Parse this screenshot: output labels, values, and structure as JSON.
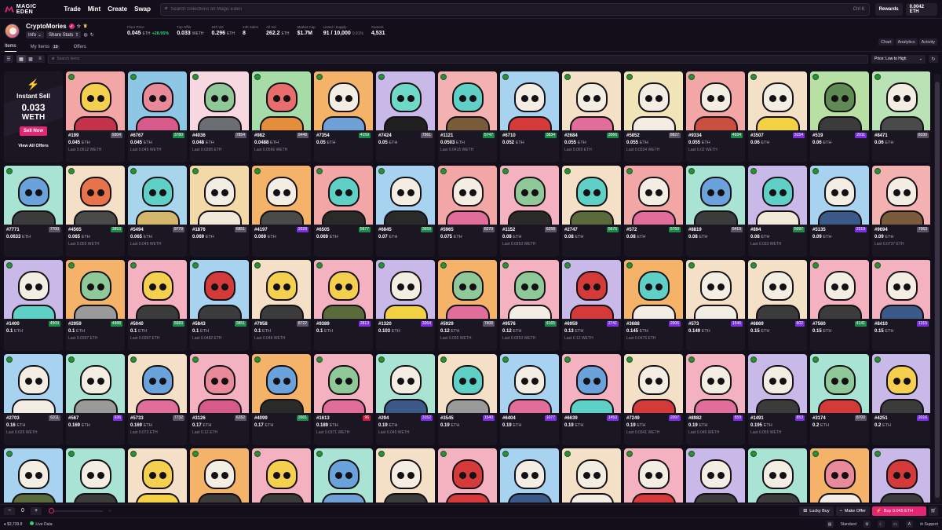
{
  "nav": {
    "logo_text": "MAGIC EDEN",
    "links": [
      "Trade",
      "Mint",
      "Create",
      "Swap"
    ],
    "search_placeholder": "Search collections on Magic Eden",
    "search_shortcut": "Ctrl K",
    "rewards_label": "Rewards",
    "balance": "0.0042 ETH"
  },
  "collection": {
    "name": "CryptoMories",
    "info_label": "Info",
    "share_label": "Share Stats",
    "stats": [
      {
        "label": "Floor Price",
        "value": "0.045",
        "unit": "ETH",
        "extra": "+28.95%"
      },
      {
        "label": "Top Offer",
        "value": "0.033",
        "unit": "WETH",
        "extra": ""
      },
      {
        "label": "24h Vol",
        "value": "0.296",
        "unit": "ETH",
        "extra": ""
      },
      {
        "label": "24h Sales",
        "value": "8",
        "unit": "",
        "extra": ""
      },
      {
        "label": "All Vol",
        "value": "262.2",
        "unit": "ETH",
        "extra": ""
      },
      {
        "label": "Market Cap",
        "value": "$1.7M",
        "unit": "",
        "extra": ""
      },
      {
        "label": "Listed / Supply",
        "value": "91 / 10,000",
        "unit": "",
        "extra": "0.91%"
      },
      {
        "label": "Owners",
        "value": "4,531",
        "unit": "",
        "extra": ""
      }
    ]
  },
  "tabs": {
    "items": "Items",
    "my_items": "My Items",
    "my_items_count": "19",
    "offers": "Offers",
    "right": [
      "Chart",
      "Analytics",
      "Activity"
    ]
  },
  "toolbar": {
    "search_placeholder": "Search items",
    "sort_label": "Price: Low to High"
  },
  "instant_sell": {
    "title": "Instant Sell",
    "value": "0.033",
    "unit": "WETH",
    "button": "Sell Now",
    "view_all": "View All Offers"
  },
  "colors": {
    "accent": "#e42575",
    "rank_gray": "#5b5368",
    "rank_green": "#1d8a4c",
    "rank_purple": "#7a2fe0",
    "rank_red": "#d11a3c"
  },
  "items": [
    {
      "id": "#199",
      "rank": "9304",
      "tier": "gray",
      "price": "0.045",
      "last": "Last 0.0512 WETH",
      "bg": "#f3a6a6",
      "skull": "#f4d04e",
      "body": "#c4334b"
    },
    {
      "id": "#6767",
      "rank": "3780",
      "tier": "green",
      "price": "0.045",
      "last": "Last 0.045 WETH",
      "bg": "#8ec7e6",
      "skull": "#e98a9b",
      "body": "#d65a8a"
    },
    {
      "id": "#4036",
      "rank": "7854",
      "tier": "gray",
      "price": "0.048",
      "last": "Last 0.0395 ETH",
      "bg": "#f7d8e0",
      "skull": "#8fc99a",
      "body": "#6c6e74"
    },
    {
      "id": "#982",
      "rank": "9448",
      "tier": "gray",
      "price": "0.0488",
      "last": "Last 0.0566 WETH",
      "bg": "#a5dca8",
      "skull": "#ea6d6d",
      "body": "#e48d3a"
    },
    {
      "id": "#7354",
      "rank": "4159",
      "tier": "green",
      "price": "0.05",
      "last": "",
      "bg": "#f5b36a",
      "skull": "#f4ede4",
      "body": "#6fa0d6"
    },
    {
      "id": "#7424",
      "rank": "7561",
      "tier": "gray",
      "price": "0.05",
      "last": "",
      "bg": "#c9b9e8",
      "skull": "#6ed9c7",
      "body": "#202020"
    },
    {
      "id": "#1121",
      "rank": "5747",
      "tier": "green",
      "price": "0.0503",
      "last": "Last 0.0415 WETH",
      "bg": "#f4b1b1",
      "skull": "#5fd0c5",
      "body": "#7a5c3a"
    },
    {
      "id": "#6710",
      "rank": "3834",
      "tier": "green",
      "price": "0.052",
      "last": "",
      "bg": "#a7d2f0",
      "skull": "#f4ede4",
      "body": "#d43a3a"
    },
    {
      "id": "#2684",
      "rank": "3566",
      "tier": "green",
      "price": "0.055",
      "last": "Last 0.069 ETH",
      "bg": "#f4e0c7",
      "skull": "#f4ede4",
      "body": "#e06d9a"
    },
    {
      "id": "#5852",
      "rank": "8827",
      "tier": "gray",
      "price": "0.055",
      "last": "Last 0.0324 WETH",
      "bg": "#f0e4b8",
      "skull": "#f4ede4",
      "body": "#f4ede4"
    },
    {
      "id": "#9334",
      "rank": "4934",
      "tier": "green",
      "price": "0.055",
      "last": "Last 0.02 WETH",
      "bg": "#f2a6a6",
      "skull": "#f4ede4",
      "body": "#c9503f"
    },
    {
      "id": "#3507",
      "rank": "3154",
      "tier": "purple",
      "price": "0.06",
      "last": "",
      "bg": "#f4e0c7",
      "skull": "#f4ede4",
      "body": "#f2d244"
    },
    {
      "id": "#519",
      "rank": "2011",
      "tier": "purple",
      "price": "0.06",
      "last": "",
      "bg": "#b8e0a5",
      "skull": "#5f8a54",
      "body": "#3b3b3b"
    },
    {
      "id": "#8471",
      "rank": "8330",
      "tier": "gray",
      "price": "0.06",
      "last": "",
      "bg": "#b9e3b5",
      "skull": "#f4ede4",
      "body": "#4a4a4a"
    },
    {
      "id": "#7771",
      "rank": "7700",
      "tier": "gray",
      "price": "0.0633",
      "last": "",
      "bg": "#a9e3d3",
      "skull": "#6aa2dc",
      "body": "#3b3b3b"
    },
    {
      "id": "#4565",
      "rank": "3853",
      "tier": "green",
      "price": "0.065",
      "last": "Last 0.055 WETH",
      "bg": "#f4e0c7",
      "skull": "#e8734a",
      "body": "#4a4a4a"
    },
    {
      "id": "#5494",
      "rank": "9779",
      "tier": "gray",
      "price": "0.065",
      "last": "Last 0.045 WETH",
      "bg": "#a7d6ec",
      "skull": "#5fd0c5",
      "body": "#d4b66c"
    },
    {
      "id": "#1876",
      "rank": "6851",
      "tier": "gray",
      "price": "0.069",
      "last": "",
      "bg": "#f4d9a8",
      "skull": "#f4ede4",
      "body": "#f0e8d8"
    },
    {
      "id": "#4197",
      "rank": "2028",
      "tier": "purple",
      "price": "0.069",
      "last": "",
      "bg": "#f5b36a",
      "skull": "#f4ede4",
      "body": "#4a4a4a"
    },
    {
      "id": "#6505",
      "rank": "5677",
      "tier": "green",
      "price": "0.069",
      "last": "",
      "bg": "#f2a6a6",
      "skull": "#5fd0c5",
      "body": "#2a2a2a"
    },
    {
      "id": "#6845",
      "rank": "3659",
      "tier": "green",
      "price": "0.07",
      "last": "",
      "bg": "#a7d2f0",
      "skull": "#f4ede4",
      "body": "#2a2a2a"
    },
    {
      "id": "#5965",
      "rank": "8270",
      "tier": "gray",
      "price": "0.075",
      "last": "",
      "bg": "#f2a6a6",
      "skull": "#f4ede4",
      "body": "#e06d9a"
    },
    {
      "id": "#1152",
      "rank": "6258",
      "tier": "gray",
      "price": "0.08",
      "last": "Last 0.0353 WETH",
      "bg": "#f4b1c0",
      "skull": "#8fc99a",
      "body": "#2a2a2a"
    },
    {
      "id": "#2747",
      "rank": "5676",
      "tier": "green",
      "price": "0.08",
      "last": "",
      "bg": "#f4e0c7",
      "skull": "#5fd0c5",
      "body": "#5a6a3a"
    },
    {
      "id": "#572",
      "rank": "5760",
      "tier": "green",
      "price": "0.08",
      "last": "",
      "bg": "#f2a6a6",
      "skull": "#f4ede4",
      "body": "#e06d9a"
    },
    {
      "id": "#8819",
      "rank": "6419",
      "tier": "gray",
      "price": "0.08",
      "last": "",
      "bg": "#a9e3d3",
      "skull": "#6aa2dc",
      "body": "#3b3b3b"
    },
    {
      "id": "#894",
      "rank": "5097",
      "tier": "green",
      "price": "0.08",
      "last": "Last 0.033 WETH",
      "bg": "#c9b9e8",
      "skull": "#5fd0c5",
      "body": "#f0e8d8"
    },
    {
      "id": "#5135",
      "rank": "2219",
      "tier": "purple",
      "price": "0.09",
      "last": "",
      "bg": "#a7d2f0",
      "skull": "#f4ede4",
      "body": "#3b5a8a"
    },
    {
      "id": "#9694",
      "rank": "7063",
      "tier": "gray",
      "price": "0.09",
      "last": "Last 0.0737 ETH",
      "bg": "#f4b1b1",
      "skull": "#f4ede4",
      "body": "#7a5c3a"
    },
    {
      "id": "#1400",
      "rank": "4509",
      "tier": "green",
      "price": "0.1",
      "last": "",
      "bg": "#c9b9e8",
      "skull": "#f4ede4",
      "body": "#5fd0c5"
    },
    {
      "id": "#2959",
      "rank": "4488",
      "tier": "green",
      "price": "0.1",
      "last": "Last 0.0397 ETH",
      "bg": "#f5b36a",
      "skull": "#8fc99a",
      "body": "#9a9a9a"
    },
    {
      "id": "#5040",
      "rank": "5683",
      "tier": "green",
      "price": "0.1",
      "last": "Last 0.0397 ETH",
      "bg": "#f4b1c0",
      "skull": "#f4d04e",
      "body": "#3b3b3b"
    },
    {
      "id": "#5843",
      "rank": "3851",
      "tier": "green",
      "price": "0.1",
      "last": "Last 0.0482 ETH",
      "bg": "#a7d2f0",
      "skull": "#d43a3a",
      "body": "#3b3b3b"
    },
    {
      "id": "#7958",
      "rank": "8722",
      "tier": "gray",
      "price": "0.1",
      "last": "Last 0.048 WETH",
      "bg": "#f4e0c7",
      "skull": "#f4d04e",
      "body": "#3b3b3b"
    },
    {
      "id": "#9389",
      "rank": "2813",
      "tier": "purple",
      "price": "0.1",
      "last": "",
      "bg": "#f4b1c0",
      "skull": "#f4d04e",
      "body": "#5a6a3a"
    },
    {
      "id": "#1320",
      "rank": "3264",
      "tier": "purple",
      "price": "0.103",
      "last": "",
      "bg": "#c9b9e8",
      "skull": "#f4ede4",
      "body": "#f2d244"
    },
    {
      "id": "#5929",
      "rank": "7408",
      "tier": "gray",
      "price": "0.12",
      "last": "Last 0.035 WETH",
      "bg": "#f5b36a",
      "skull": "#8fc99a",
      "body": "#e06d9a"
    },
    {
      "id": "#9576",
      "rank": "4165",
      "tier": "green",
      "price": "0.12",
      "last": "Last 0.0353 WETH",
      "bg": "#f4b1c0",
      "skull": "#8fc99a",
      "body": "#f4ede4"
    },
    {
      "id": "#6959",
      "rank": "2741",
      "tier": "purple",
      "price": "0.13",
      "last": "Last 0.12 WETH",
      "bg": "#c9b9e8",
      "skull": "#d43a3a",
      "body": "#d43a3a"
    },
    {
      "id": "#3688",
      "rank": "2006",
      "tier": "purple",
      "price": "0.145",
      "last": "Last 0.0476 ETH",
      "bg": "#f5b36a",
      "skull": "#5fd0c5",
      "body": "#f4ede4"
    },
    {
      "id": "#573",
      "rank": "1546",
      "tier": "purple",
      "price": "0.149",
      "last": "",
      "bg": "#f4e0c7",
      "skull": "#f4ede4",
      "body": "#f4ede4"
    },
    {
      "id": "#6869",
      "rank": "602",
      "tier": "purple",
      "price": "0.15",
      "last": "",
      "bg": "#f4e0c7",
      "skull": "#f4ede4",
      "body": "#3b3b3b"
    },
    {
      "id": "#7560",
      "rank": "4141",
      "tier": "green",
      "price": "0.15",
      "last": "",
      "bg": "#f4b1c0",
      "skull": "#f4ede4",
      "body": "#3b3b3b"
    },
    {
      "id": "#8410",
      "rank": "1315",
      "tier": "purple",
      "price": "0.15",
      "last": "",
      "bg": "#f4b1c0",
      "skull": "#f4ede4",
      "body": "#3b5a8a"
    },
    {
      "id": "#2703",
      "rank": "6311",
      "tier": "gray",
      "price": "0.16",
      "last": "Last 0.025 WETH",
      "bg": "#a7d2f0",
      "skull": "#f4ede4",
      "body": "#f4ede4"
    },
    {
      "id": "#567",
      "rank": "936",
      "tier": "purple",
      "price": "0.169",
      "last": "",
      "bg": "#a9e3d3",
      "skull": "#f4ede4",
      "body": "#9a9a9a"
    },
    {
      "id": "#5733",
      "rank": "7732",
      "tier": "gray",
      "price": "0.169",
      "last": "Last 0.073 ETH",
      "bg": "#f4e0c7",
      "skull": "#6aa2dc",
      "body": "#e06d9a"
    },
    {
      "id": "#3126",
      "rank": "6282",
      "tier": "gray",
      "price": "0.17",
      "last": "Last 0.12 ETH",
      "bg": "#f4b1c0",
      "skull": "#e98a9b",
      "body": "#d65a8a"
    },
    {
      "id": "#4099",
      "rank": "3581",
      "tier": "green",
      "price": "0.17",
      "last": "",
      "bg": "#f5b36a",
      "skull": "#6aa2dc",
      "body": "#2a2a2a"
    },
    {
      "id": "#1613",
      "rank": "96",
      "tier": "red",
      "price": "0.189",
      "last": "Last 0.0371 WETH",
      "bg": "#f4b1c0",
      "skull": "#8fc99a",
      "body": "#e06d9a"
    },
    {
      "id": "#294",
      "rank": "3152",
      "tier": "purple",
      "price": "0.19",
      "last": "Last 0.045 WETH",
      "bg": "#a9e3d3",
      "skull": "#f4ede4",
      "body": "#3b5a8a"
    },
    {
      "id": "#3545",
      "rank": "1540",
      "tier": "purple",
      "price": "0.19",
      "last": "",
      "bg": "#f4e0c7",
      "skull": "#5fd0c5",
      "body": "#9a9a9a"
    },
    {
      "id": "#6404",
      "rank": "1077",
      "tier": "purple",
      "price": "0.19",
      "last": "",
      "bg": "#a7d2f0",
      "skull": "#f4ede4",
      "body": "#e06d9a"
    },
    {
      "id": "#6639",
      "rank": "1453",
      "tier": "purple",
      "price": "0.19",
      "last": "",
      "bg": "#f4b1c0",
      "skull": "#6aa2dc",
      "body": "#5fd0c5"
    },
    {
      "id": "#7249",
      "rank": "2097",
      "tier": "purple",
      "price": "0.19",
      "last": "Last 0.0341 WETH",
      "bg": "#f4e0c7",
      "skull": "#f4ede4",
      "body": "#d43a3a"
    },
    {
      "id": "#8982",
      "rank": "559",
      "tier": "purple",
      "price": "0.19",
      "last": "Last 0.045 WETH",
      "bg": "#f4b1c0",
      "skull": "#f4ede4",
      "body": "#e06d9a"
    },
    {
      "id": "#1491",
      "rank": "853",
      "tier": "purple",
      "price": "0.195",
      "last": "Last 0.055 WETH",
      "bg": "#c9b9e8",
      "skull": "#f4ede4",
      "body": "#3b3b3b"
    },
    {
      "id": "#3174",
      "rank": "8700",
      "tier": "gray",
      "price": "0.2",
      "last": "",
      "bg": "#a9e3d3",
      "skull": "#8fc99a",
      "body": "#d43a3a"
    },
    {
      "id": "#4251",
      "rank": "2016",
      "tier": "purple",
      "price": "0.2",
      "last": "",
      "bg": "#c9b9e8",
      "skull": "#f4d04e",
      "body": "#3b3b3b"
    },
    {
      "id": "",
      "rank": "",
      "tier": "gray",
      "price": "",
      "last": "",
      "bg": "#a7d2f0",
      "skull": "#f4ede4",
      "body": "#5a6a3a"
    },
    {
      "id": "",
      "rank": "",
      "tier": "gray",
      "price": "",
      "last": "",
      "bg": "#a9e3d3",
      "skull": "#f4ede4",
      "body": "#3b3b3b"
    },
    {
      "id": "",
      "rank": "",
      "tier": "gray",
      "price": "",
      "last": "",
      "bg": "#f4e0c7",
      "skull": "#f4d04e",
      "body": "#f2d244"
    },
    {
      "id": "",
      "rank": "",
      "tier": "gray",
      "price": "",
      "last": "",
      "bg": "#f5b36a",
      "skull": "#f4ede4",
      "body": "#3b3b3b"
    },
    {
      "id": "",
      "rank": "",
      "tier": "gray",
      "price": "",
      "last": "",
      "bg": "#f4b1c0",
      "skull": "#f4d04e",
      "body": "#3b3b3b"
    },
    {
      "id": "",
      "rank": "",
      "tier": "gray",
      "price": "",
      "last": "",
      "bg": "#a9e3d3",
      "skull": "#6aa2dc",
      "body": "#6fa0d6"
    },
    {
      "id": "",
      "rank": "",
      "tier": "gray",
      "price": "",
      "last": "",
      "bg": "#f4e0c7",
      "skull": "#f4ede4",
      "body": "#3b3b3b"
    },
    {
      "id": "",
      "rank": "",
      "tier": "gray",
      "price": "",
      "last": "",
      "bg": "#f4b1c0",
      "skull": "#d43a3a",
      "body": "#d43a3a"
    },
    {
      "id": "",
      "rank": "",
      "tier": "gray",
      "price": "",
      "last": "",
      "bg": "#a7d2f0",
      "skull": "#f4ede4",
      "body": "#3b5a8a"
    },
    {
      "id": "",
      "rank": "",
      "tier": "gray",
      "price": "",
      "last": "",
      "bg": "#f4e0c7",
      "skull": "#f4ede4",
      "body": "#f4ede4"
    },
    {
      "id": "",
      "rank": "",
      "tier": "gray",
      "price": "",
      "last": "",
      "bg": "#f4b1c0",
      "skull": "#f4ede4",
      "body": "#d43a3a"
    },
    {
      "id": "",
      "rank": "",
      "tier": "gray",
      "price": "",
      "last": "",
      "bg": "#c9b9e8",
      "skull": "#f4ede4",
      "body": "#3b3b3b"
    },
    {
      "id": "",
      "rank": "",
      "tier": "gray",
      "price": "",
      "last": "",
      "bg": "#a9e3d3",
      "skull": "#f4ede4",
      "body": "#3b3b3b"
    },
    {
      "id": "",
      "rank": "",
      "tier": "gray",
      "price": "",
      "last": "",
      "bg": "#f5b36a",
      "skull": "#e98a9b",
      "body": "#f4ede4"
    },
    {
      "id": "",
      "rank": "",
      "tier": "gray",
      "price": "",
      "last": "",
      "bg": "#c9b9e8",
      "skull": "#d43a3a",
      "body": "#3b3b3b"
    }
  ],
  "bottom": {
    "qty_value": "0",
    "minus": "−",
    "plus": "+",
    "lucky_buy": "Lucky Buy",
    "make_offer": "Make Offer",
    "buy_label": "Buy 0.045 ETH"
  },
  "status": {
    "eth_price": "$3,739.8",
    "live_data": "Live Data",
    "mode": "Standard",
    "support": "Support"
  }
}
